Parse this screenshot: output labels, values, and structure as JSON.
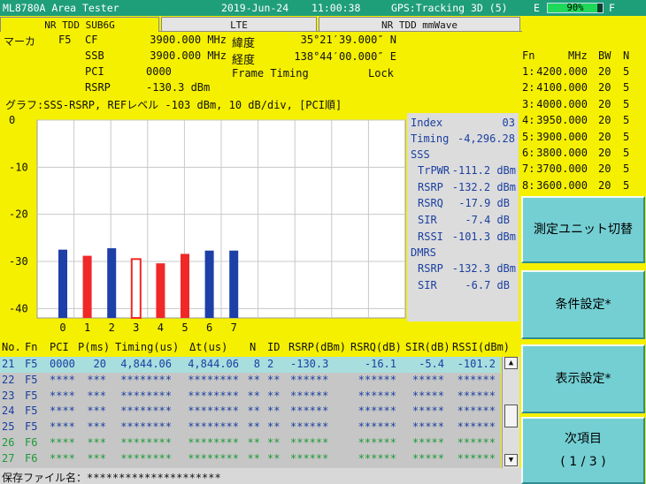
{
  "titlebar": {
    "app_name": "ML8780A Area Tester",
    "date": "2019-Jun-24",
    "time": "11:00:38",
    "gps": "GPS:Tracking 3D (5)",
    "battery_left": "E",
    "battery_pct": "90%",
    "battery_level": 0.9,
    "battery_right": "F"
  },
  "tabs": [
    {
      "label": "NR TDD SUB6G",
      "active": true
    },
    {
      "label": "LTE",
      "active": false
    },
    {
      "label": "NR TDD mmWave",
      "active": false
    }
  ],
  "marker": {
    "label": "マーカ",
    "id": "F5",
    "cf_label": "CF",
    "cf_value": "3900.000 MHz",
    "ssb_label": "SSB",
    "ssb_value": "3900.000 MHz",
    "pci_label": "PCI",
    "pci_value": "0000",
    "rsrp_label": "RSRP",
    "rsrp_value": "-130.3 dBm",
    "lat_label": "緯度",
    "lat_value": "35°21′39.000″ N",
    "lon_label": "経度",
    "lon_value": "138°44′00.000″ E",
    "frame_label": "Frame Timing",
    "frame_value": "Lock"
  },
  "freq_list": {
    "headers": [
      "Fn",
      "MHz",
      "BW",
      "N"
    ],
    "rows": [
      {
        "fn": "1:",
        "mhz": "4200.000",
        "bw": "20",
        "n": "5"
      },
      {
        "fn": "2:",
        "mhz": "4100.000",
        "bw": "20",
        "n": "5"
      },
      {
        "fn": "3:",
        "mhz": "4000.000",
        "bw": "20",
        "n": "5"
      },
      {
        "fn": "4:",
        "mhz": "3950.000",
        "bw": "20",
        "n": "5"
      },
      {
        "fn": "5:",
        "mhz": "3900.000",
        "bw": "20",
        "n": "5"
      },
      {
        "fn": "6:",
        "mhz": "3800.000",
        "bw": "20",
        "n": "5"
      },
      {
        "fn": "7:",
        "mhz": "3700.000",
        "bw": "20",
        "n": "5"
      },
      {
        "fn": "8:",
        "mhz": "3600.000",
        "bw": "20",
        "n": "5"
      }
    ]
  },
  "graph_header": "グラフ:SSS-RSRP, REFレベル -103 dBm, 10 dB/div, [PCI順]",
  "chart_data": {
    "type": "bar",
    "categories": [
      "0",
      "1",
      "2",
      "3",
      "4",
      "5",
      "6",
      "7"
    ],
    "values": [
      -27.5,
      -28.8,
      -27.2,
      -29.5,
      -30.4,
      -28.4,
      -27.7,
      -27.7
    ],
    "bar_colors": [
      "#1d3fa8",
      "#f02828",
      "#1d3fa8",
      "#f02828",
      "#f02828",
      "#f02828",
      "#1d3fa8",
      "#1d3fa8"
    ],
    "selected_index": 3,
    "ylim": [
      -42,
      0
    ],
    "yticks": [
      0,
      -10,
      -20,
      -30,
      -40
    ],
    "ytick_labels": [
      "0",
      "-10",
      "-20",
      "-30",
      "-40"
    ],
    "grid": true
  },
  "side_panel": {
    "index_label": "Index",
    "index_value": "03",
    "timing_label": "Timing",
    "timing_value": "-4,296.28",
    "sss_label": "SSS",
    "sss_trpwr_label": "TrPWR",
    "sss_trpwr_value": "-111.2 dBm",
    "sss_rsrp_label": "RSRP",
    "sss_rsrp_value": "-132.2 dBm",
    "sss_rsrq_label": "RSRQ",
    "sss_rsrq_value": "-17.9 dB",
    "sss_sir_label": "SIR",
    "sss_sir_value": "-7.4 dB",
    "sss_rssi_label": "RSSI",
    "sss_rssi_value": "-101.3 dBm",
    "dmrs_label": "DMRS",
    "dmrs_rsrp_label": "RSRP",
    "dmrs_rsrp_value": "-132.3 dBm",
    "dmrs_sir_label": "SIR",
    "dmrs_sir_value": "-6.7 dB"
  },
  "buttons": {
    "measure_unit": "測定ユニット切替",
    "condition": "条件設定*",
    "display": "表示設定*",
    "next_label": "次項目",
    "next_page": "( 1 / 3 )"
  },
  "table": {
    "headers": {
      "no": "No.",
      "fn": "Fn",
      "pci": "PCI",
      "pms": "P(ms)",
      "timing": "Timing(us)",
      "dt": "Δt(us)",
      "n": "N",
      "id": "ID",
      "rsrp": "RSRP(dBm)",
      "rsrq": "RSRQ(dB)",
      "sir": "SIR(dB)",
      "rssi": "RSSI(dBm)"
    },
    "rows": [
      {
        "no": "21",
        "fn": "F5",
        "pci": "0000",
        "pms": "20",
        "timing": "4,844.06",
        "dt": "4,844.06",
        "n": "8",
        "id": "2",
        "rsrp": "-130.3",
        "rsrq": "-16.1",
        "sir": "-5.4",
        "rssi": "-101.2",
        "color": "#1a3fa0",
        "selected": true
      },
      {
        "no": "22",
        "fn": "F5",
        "pci": "****",
        "pms": "***",
        "timing": "********",
        "dt": "********",
        "n": "**",
        "id": "**",
        "rsrp": "******",
        "rsrq": "******",
        "sir": "*****",
        "rssi": "******",
        "color": "#1a3fa0",
        "selected": false
      },
      {
        "no": "23",
        "fn": "F5",
        "pci": "****",
        "pms": "***",
        "timing": "********",
        "dt": "********",
        "n": "**",
        "id": "**",
        "rsrp": "******",
        "rsrq": "******",
        "sir": "*****",
        "rssi": "******",
        "color": "#1a3fa0",
        "selected": false
      },
      {
        "no": "24",
        "fn": "F5",
        "pci": "****",
        "pms": "***",
        "timing": "********",
        "dt": "********",
        "n": "**",
        "id": "**",
        "rsrp": "******",
        "rsrq": "******",
        "sir": "*****",
        "rssi": "******",
        "color": "#1a3fa0",
        "selected": false
      },
      {
        "no": "25",
        "fn": "F5",
        "pci": "****",
        "pms": "***",
        "timing": "********",
        "dt": "********",
        "n": "**",
        "id": "**",
        "rsrp": "******",
        "rsrq": "******",
        "sir": "*****",
        "rssi": "******",
        "color": "#1a3fa0",
        "selected": false
      },
      {
        "no": "26",
        "fn": "F6",
        "pci": "****",
        "pms": "***",
        "timing": "********",
        "dt": "********",
        "n": "**",
        "id": "**",
        "rsrp": "******",
        "rsrq": "******",
        "sir": "*****",
        "rssi": "******",
        "color": "#1c9a36",
        "selected": false
      },
      {
        "no": "27",
        "fn": "F6",
        "pci": "****",
        "pms": "***",
        "timing": "********",
        "dt": "********",
        "n": "**",
        "id": "**",
        "rsrp": "******",
        "rsrq": "******",
        "sir": "*****",
        "rssi": "******",
        "color": "#1c9a36",
        "selected": false
      }
    ]
  },
  "scrollbar": {
    "up_icon": "▲",
    "down_icon": "▼"
  },
  "status": {
    "label": "保存ファイル名：",
    "value": "*********************"
  },
  "colors": {
    "background": "#f5f000",
    "titlebar": "#1f9e7a",
    "button": "#74cfd3",
    "blue_text": "#1a3fa0",
    "green_text": "#1c9a36"
  }
}
